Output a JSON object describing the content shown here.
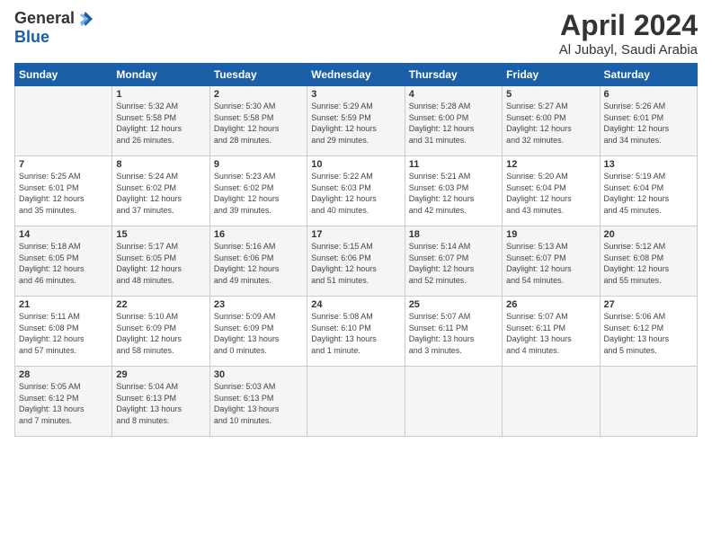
{
  "header": {
    "logo_general": "General",
    "logo_blue": "Blue",
    "month_title": "April 2024",
    "location": "Al Jubayl, Saudi Arabia"
  },
  "weekdays": [
    "Sunday",
    "Monday",
    "Tuesday",
    "Wednesday",
    "Thursday",
    "Friday",
    "Saturday"
  ],
  "weeks": [
    [
      {
        "day": "",
        "info": ""
      },
      {
        "day": "1",
        "info": "Sunrise: 5:32 AM\nSunset: 5:58 PM\nDaylight: 12 hours\nand 26 minutes."
      },
      {
        "day": "2",
        "info": "Sunrise: 5:30 AM\nSunset: 5:58 PM\nDaylight: 12 hours\nand 28 minutes."
      },
      {
        "day": "3",
        "info": "Sunrise: 5:29 AM\nSunset: 5:59 PM\nDaylight: 12 hours\nand 29 minutes."
      },
      {
        "day": "4",
        "info": "Sunrise: 5:28 AM\nSunset: 6:00 PM\nDaylight: 12 hours\nand 31 minutes."
      },
      {
        "day": "5",
        "info": "Sunrise: 5:27 AM\nSunset: 6:00 PM\nDaylight: 12 hours\nand 32 minutes."
      },
      {
        "day": "6",
        "info": "Sunrise: 5:26 AM\nSunset: 6:01 PM\nDaylight: 12 hours\nand 34 minutes."
      }
    ],
    [
      {
        "day": "7",
        "info": "Sunrise: 5:25 AM\nSunset: 6:01 PM\nDaylight: 12 hours\nand 35 minutes."
      },
      {
        "day": "8",
        "info": "Sunrise: 5:24 AM\nSunset: 6:02 PM\nDaylight: 12 hours\nand 37 minutes."
      },
      {
        "day": "9",
        "info": "Sunrise: 5:23 AM\nSunset: 6:02 PM\nDaylight: 12 hours\nand 39 minutes."
      },
      {
        "day": "10",
        "info": "Sunrise: 5:22 AM\nSunset: 6:03 PM\nDaylight: 12 hours\nand 40 minutes."
      },
      {
        "day": "11",
        "info": "Sunrise: 5:21 AM\nSunset: 6:03 PM\nDaylight: 12 hours\nand 42 minutes."
      },
      {
        "day": "12",
        "info": "Sunrise: 5:20 AM\nSunset: 6:04 PM\nDaylight: 12 hours\nand 43 minutes."
      },
      {
        "day": "13",
        "info": "Sunrise: 5:19 AM\nSunset: 6:04 PM\nDaylight: 12 hours\nand 45 minutes."
      }
    ],
    [
      {
        "day": "14",
        "info": "Sunrise: 5:18 AM\nSunset: 6:05 PM\nDaylight: 12 hours\nand 46 minutes."
      },
      {
        "day": "15",
        "info": "Sunrise: 5:17 AM\nSunset: 6:05 PM\nDaylight: 12 hours\nand 48 minutes."
      },
      {
        "day": "16",
        "info": "Sunrise: 5:16 AM\nSunset: 6:06 PM\nDaylight: 12 hours\nand 49 minutes."
      },
      {
        "day": "17",
        "info": "Sunrise: 5:15 AM\nSunset: 6:06 PM\nDaylight: 12 hours\nand 51 minutes."
      },
      {
        "day": "18",
        "info": "Sunrise: 5:14 AM\nSunset: 6:07 PM\nDaylight: 12 hours\nand 52 minutes."
      },
      {
        "day": "19",
        "info": "Sunrise: 5:13 AM\nSunset: 6:07 PM\nDaylight: 12 hours\nand 54 minutes."
      },
      {
        "day": "20",
        "info": "Sunrise: 5:12 AM\nSunset: 6:08 PM\nDaylight: 12 hours\nand 55 minutes."
      }
    ],
    [
      {
        "day": "21",
        "info": "Sunrise: 5:11 AM\nSunset: 6:08 PM\nDaylight: 12 hours\nand 57 minutes."
      },
      {
        "day": "22",
        "info": "Sunrise: 5:10 AM\nSunset: 6:09 PM\nDaylight: 12 hours\nand 58 minutes."
      },
      {
        "day": "23",
        "info": "Sunrise: 5:09 AM\nSunset: 6:09 PM\nDaylight: 13 hours\nand 0 minutes."
      },
      {
        "day": "24",
        "info": "Sunrise: 5:08 AM\nSunset: 6:10 PM\nDaylight: 13 hours\nand 1 minute."
      },
      {
        "day": "25",
        "info": "Sunrise: 5:07 AM\nSunset: 6:11 PM\nDaylight: 13 hours\nand 3 minutes."
      },
      {
        "day": "26",
        "info": "Sunrise: 5:07 AM\nSunset: 6:11 PM\nDaylight: 13 hours\nand 4 minutes."
      },
      {
        "day": "27",
        "info": "Sunrise: 5:06 AM\nSunset: 6:12 PM\nDaylight: 13 hours\nand 5 minutes."
      }
    ],
    [
      {
        "day": "28",
        "info": "Sunrise: 5:05 AM\nSunset: 6:12 PM\nDaylight: 13 hours\nand 7 minutes."
      },
      {
        "day": "29",
        "info": "Sunrise: 5:04 AM\nSunset: 6:13 PM\nDaylight: 13 hours\nand 8 minutes."
      },
      {
        "day": "30",
        "info": "Sunrise: 5:03 AM\nSunset: 6:13 PM\nDaylight: 13 hours\nand 10 minutes."
      },
      {
        "day": "",
        "info": ""
      },
      {
        "day": "",
        "info": ""
      },
      {
        "day": "",
        "info": ""
      },
      {
        "day": "",
        "info": ""
      }
    ]
  ]
}
